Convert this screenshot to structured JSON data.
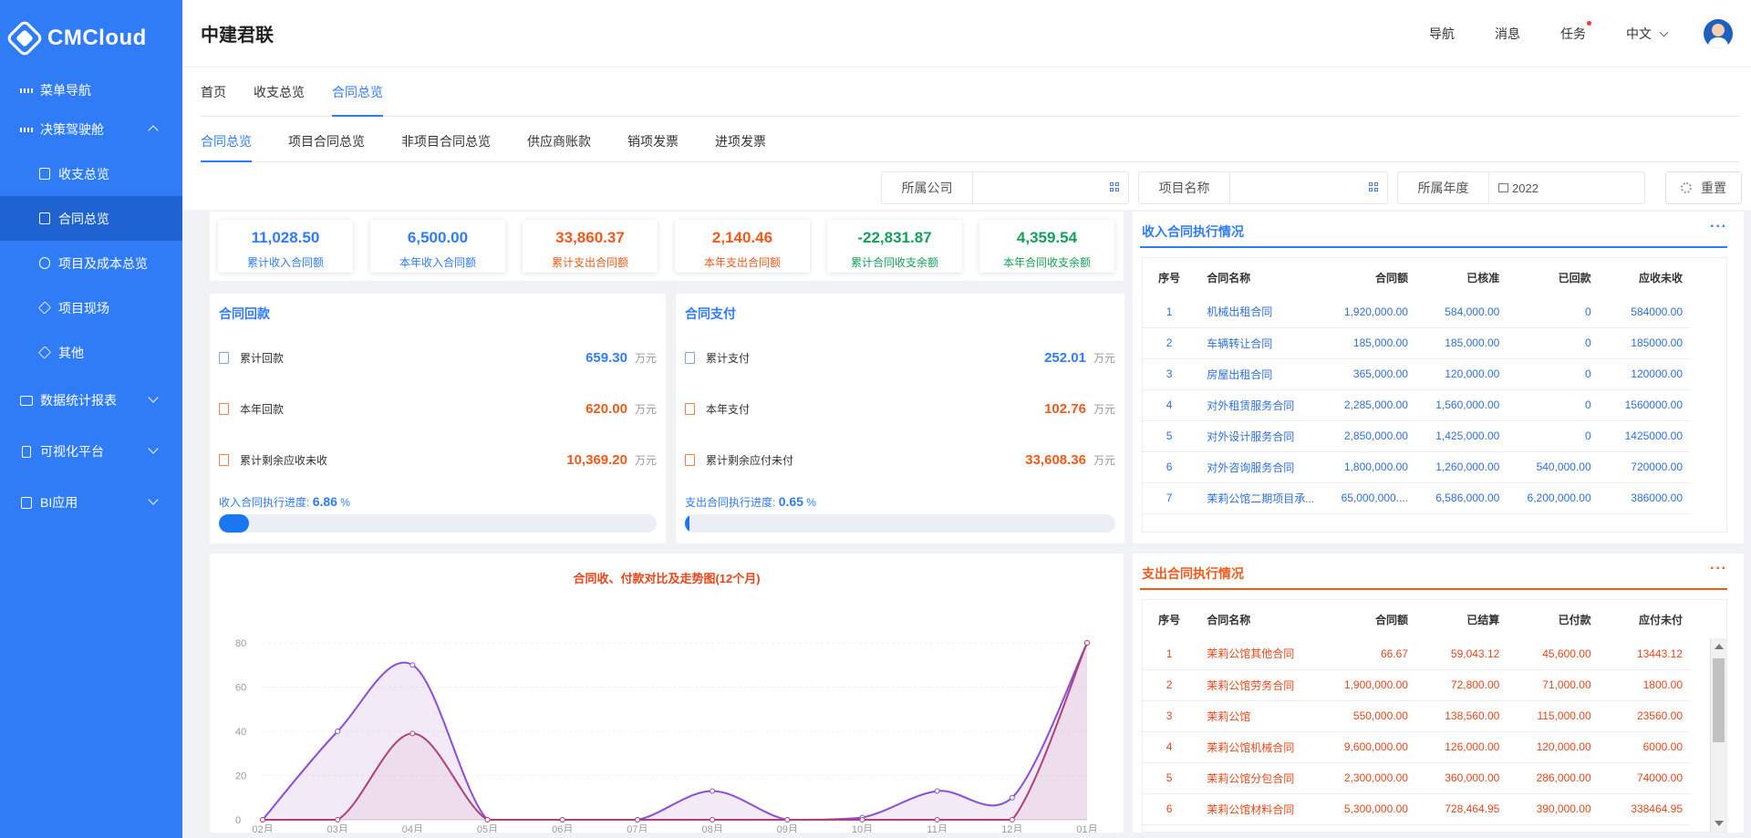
{
  "sidebar": {
    "logo": "CMCloud",
    "items": [
      {
        "label": "菜单导航"
      },
      {
        "label": "决策驾驶舱"
      },
      {
        "label": "收支总览"
      },
      {
        "label": "合同总览"
      },
      {
        "label": "项目及成本总览"
      },
      {
        "label": "项目现场"
      },
      {
        "label": "其他"
      },
      {
        "label": "数据统计报表"
      },
      {
        "label": "可视化平台"
      },
      {
        "label": "BI应用"
      }
    ]
  },
  "header": {
    "company": "中建君联",
    "nav": "导航",
    "messages": "消息",
    "tasks": "任务",
    "lang": "中文"
  },
  "tabs": [
    "首页",
    "收支总览",
    "合同总览"
  ],
  "subtabs": [
    "合同总览",
    "项目合同总览",
    "非项目合同总览",
    "供应商账款",
    "销项发票",
    "进项发票"
  ],
  "filters": {
    "company": {
      "label": "所属公司",
      "value": ""
    },
    "project": {
      "label": "项目名称",
      "value": ""
    },
    "year": {
      "label": "所属年度",
      "value": "2022"
    },
    "reset": "重置"
  },
  "stats": [
    {
      "value": "11,028.50",
      "label": "累计收入合同额",
      "color": "#2f7cf6"
    },
    {
      "value": "6,500.00",
      "label": "本年收入合同额",
      "color": "#2f7cf6"
    },
    {
      "value": "33,860.37",
      "label": "累计支出合同额",
      "color": "#f05a1a"
    },
    {
      "value": "2,140.46",
      "label": "本年支出合同额",
      "color": "#f05a1a"
    },
    {
      "value": "-22,831.87",
      "label": "累计合同收支余额",
      "color": "#14a05a"
    },
    {
      "value": "4,359.54",
      "label": "本年合同收支余额",
      "color": "#14a05a"
    }
  ],
  "receipt": {
    "title": "合同回款",
    "rows": [
      {
        "label": "累计回款",
        "value": "659.30",
        "unit": "万元"
      },
      {
        "label": "本年回款",
        "value": "620.00",
        "unit": "万元"
      },
      {
        "label": "累计剩余应收未收",
        "value": "10,369.20",
        "unit": "万元"
      }
    ],
    "progress_label": "收入合同执行进度:",
    "progress_value": "6.86",
    "progress_unit": "%",
    "progress": 6.86
  },
  "payment": {
    "title": "合同支付",
    "rows": [
      {
        "label": "累计支付",
        "value": "252.01",
        "unit": "万元"
      },
      {
        "label": "本年支付",
        "value": "102.76",
        "unit": "万元"
      },
      {
        "label": "累计剩余应付未付",
        "value": "33,608.36",
        "unit": "万元"
      }
    ],
    "progress_label": "支出合同执行进度:",
    "progress_value": "0.65",
    "progress_unit": "%",
    "progress": 0.65
  },
  "income_table": {
    "title": "收入合同执行情况",
    "more": "···",
    "columns": [
      "序号",
      "合同名称",
      "合同额",
      "已核准",
      "已回款",
      "应收未收"
    ],
    "rows": [
      [
        "1",
        "机械出租合同",
        "1,920,000.00",
        "584,000.00",
        "0",
        "584000.00"
      ],
      [
        "2",
        "车辆转让合同",
        "185,000.00",
        "185,000.00",
        "0",
        "185000.00"
      ],
      [
        "3",
        "房屋出租合同",
        "365,000.00",
        "120,000.00",
        "0",
        "120000.00"
      ],
      [
        "4",
        "对外租赁服务合同",
        "2,285,000.00",
        "1,560,000.00",
        "0",
        "1560000.00"
      ],
      [
        "5",
        "对外设计服务合同",
        "2,850,000.00",
        "1,425,000.00",
        "0",
        "1425000.00"
      ],
      [
        "6",
        "对外咨询服务合同",
        "1,800,000.00",
        "1,260,000.00",
        "540,000.00",
        "720000.00"
      ],
      [
        "7",
        "茉莉公馆二期项目承...",
        "65,000,000....",
        "6,586,000.00",
        "6,200,000.00",
        "386000.00"
      ]
    ]
  },
  "expense_table": {
    "title": "支出合同执行情况",
    "more": "···",
    "columns": [
      "序号",
      "合同名称",
      "合同额",
      "已结算",
      "已付款",
      "应付未付"
    ],
    "rows": [
      [
        "1",
        "茉莉公馆其他合同",
        "66.67",
        "59,043.12",
        "45,600.00",
        "13443.12"
      ],
      [
        "2",
        "茉莉公馆劳务合同",
        "1,900,000.00",
        "72,800.00",
        "71,000.00",
        "1800.00"
      ],
      [
        "3",
        "茉莉公馆",
        "550,000.00",
        "138,560.00",
        "115,000.00",
        "23560.00"
      ],
      [
        "4",
        "茉莉公馆机械合同",
        "9,600,000.00",
        "126,000.00",
        "120,000.00",
        "6000.00"
      ],
      [
        "5",
        "茉莉公馆分包合同",
        "2,300,000.00",
        "360,000.00",
        "286,000.00",
        "74000.00"
      ],
      [
        "6",
        "茉莉公馆材料合同",
        "5,300,000.00",
        "728,464.95",
        "390,000.00",
        "338464.95"
      ]
    ]
  },
  "chart_data": {
    "type": "area",
    "title": "合同收、付款对比及走势图(12个月)",
    "categories": [
      "02月",
      "03月",
      "04月",
      "05月",
      "06月",
      "07月",
      "08月",
      "09月",
      "10月",
      "11月",
      "12月",
      "01月"
    ],
    "series": [
      {
        "values": [
          0,
          40,
          70,
          0,
          0,
          0,
          13,
          0,
          1,
          13,
          10,
          80
        ],
        "color": "#8a4fd8"
      },
      {
        "values": [
          0,
          0,
          39,
          0,
          0,
          0,
          0,
          0,
          0,
          0,
          0,
          80
        ],
        "color": "#b0407a"
      }
    ],
    "ylim": [
      0,
      80
    ],
    "yticks": [
      0,
      20,
      40,
      60,
      80
    ],
    "grid": true
  }
}
